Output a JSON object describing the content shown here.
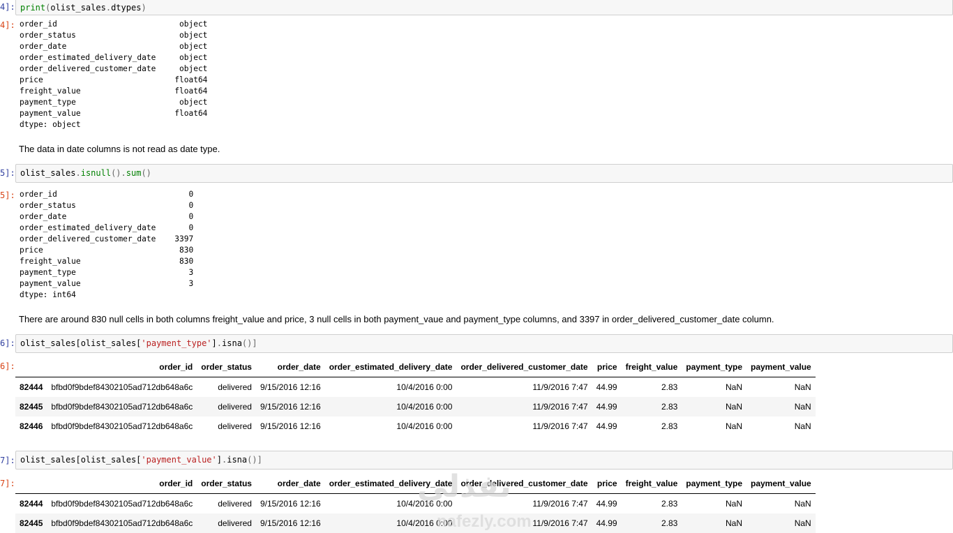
{
  "cells": [
    {
      "in_prompt": "4]:",
      "code_parts": [
        {
          "t": "fn",
          "s": "print"
        },
        {
          "t": "op",
          "s": "("
        },
        {
          "t": "plain",
          "s": "olist_sales"
        },
        {
          "t": "op",
          "s": "."
        },
        {
          "t": "plain",
          "s": "dtypes"
        },
        {
          "t": "op",
          "s": ")"
        }
      ],
      "out_prompt": "4]:",
      "output_text": "order_id                          object\norder_status                      object\norder_date                        object\norder_estimated_delivery_date     object\norder_delivered_customer_date     object\nprice                            float64\nfreight_value                    float64\npayment_type                      object\npayment_value                    float64\ndtype: object"
    },
    {
      "markdown": "The data in date columns is not read as date type."
    },
    {
      "in_prompt": "5]:",
      "code_parts": [
        {
          "t": "plain",
          "s": "olist_sales"
        },
        {
          "t": "op",
          "s": "."
        },
        {
          "t": "fn",
          "s": "isnull"
        },
        {
          "t": "op",
          "s": "()."
        },
        {
          "t": "fn",
          "s": "sum"
        },
        {
          "t": "op",
          "s": "()"
        }
      ],
      "out_prompt": "5]:",
      "output_text": "order_id                            0\norder_status                        0\norder_date                          0\norder_estimated_delivery_date       0\norder_delivered_customer_date    3397\nprice                             830\nfreight_value                     830\npayment_type                        3\npayment_value                       3\ndtype: int64"
    },
    {
      "markdown": "There are around 830 null cells in both columns freight_value and price, 3 null cells in both payment_vaue and payment_type columns, and 3397 in order_delivered_customer_date column."
    },
    {
      "in_prompt": "6]:",
      "code_parts": [
        {
          "t": "plain",
          "s": "olist_sales[olist_sales["
        },
        {
          "t": "str",
          "s": "'payment_type'"
        },
        {
          "t": "plain",
          "s": "]"
        },
        {
          "t": "op",
          "s": "."
        },
        {
          "t": "plain",
          "s": "isna"
        },
        {
          "t": "op",
          "s": "()]"
        }
      ],
      "out_prompt": "6]:",
      "table": {
        "columns": [
          "order_id",
          "order_status",
          "order_date",
          "order_estimated_delivery_date",
          "order_delivered_customer_date",
          "price",
          "freight_value",
          "payment_type",
          "payment_value"
        ],
        "rows": [
          {
            "index": "82444",
            "cells": [
              "bfbd0f9bdef84302105ad712db648a6c",
              "delivered",
              "9/15/2016 12:16",
              "10/4/2016 0:00",
              "11/9/2016 7:47",
              "44.99",
              "2.83",
              "NaN",
              "NaN"
            ]
          },
          {
            "index": "82445",
            "cells": [
              "bfbd0f9bdef84302105ad712db648a6c",
              "delivered",
              "9/15/2016 12:16",
              "10/4/2016 0:00",
              "11/9/2016 7:47",
              "44.99",
              "2.83",
              "NaN",
              "NaN"
            ]
          },
          {
            "index": "82446",
            "cells": [
              "bfbd0f9bdef84302105ad712db648a6c",
              "delivered",
              "9/15/2016 12:16",
              "10/4/2016 0:00",
              "11/9/2016 7:47",
              "44.99",
              "2.83",
              "NaN",
              "NaN"
            ]
          }
        ]
      }
    },
    {
      "in_prompt": "7]:",
      "code_parts": [
        {
          "t": "plain",
          "s": "olist_sales[olist_sales["
        },
        {
          "t": "str",
          "s": "'payment_value'"
        },
        {
          "t": "plain",
          "s": "]"
        },
        {
          "t": "op",
          "s": "."
        },
        {
          "t": "plain",
          "s": "isna"
        },
        {
          "t": "op",
          "s": "()]"
        }
      ],
      "out_prompt": "7]:",
      "table": {
        "columns": [
          "order_id",
          "order_status",
          "order_date",
          "order_estimated_delivery_date",
          "order_delivered_customer_date",
          "price",
          "freight_value",
          "payment_type",
          "payment_value"
        ],
        "rows": [
          {
            "index": "82444",
            "cells": [
              "bfbd0f9bdef84302105ad712db648a6c",
              "delivered",
              "9/15/2016 12:16",
              "10/4/2016 0:00",
              "11/9/2016 7:47",
              "44.99",
              "2.83",
              "NaN",
              "NaN"
            ]
          },
          {
            "index": "82445",
            "cells": [
              "bfbd0f9bdef84302105ad712db648a6c",
              "delivered",
              "9/15/2016 12:16",
              "10/4/2016 0:00",
              "11/9/2016 7:47",
              "44.99",
              "2.83",
              "NaN",
              "NaN"
            ]
          }
        ]
      }
    }
  ],
  "watermark": {
    "arabic": "نفذلي",
    "latin": "nafezly.com"
  },
  "colors": {
    "input_bg": "#f7f7f7",
    "input_border": "#cfcfcf",
    "prompt_in": "#303f9f",
    "prompt_out": "#d84315",
    "row_stripe": "#f5f5f5"
  }
}
